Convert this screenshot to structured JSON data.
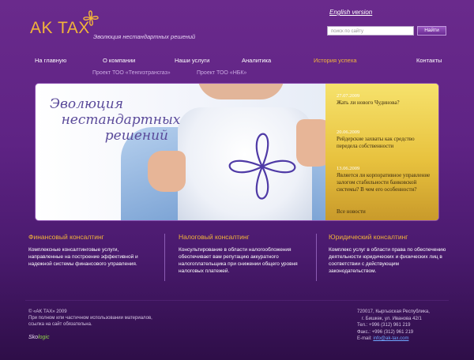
{
  "header": {
    "logo_text": "AK TAX",
    "tagline": "Эволюция нестандартных решений",
    "english_link": "English version",
    "search_placeholder": "поиск по сайту",
    "search_button": "Найти",
    "accent_color": "#f2b43a"
  },
  "nav": {
    "items": [
      {
        "label": "На главную"
      },
      {
        "label": "О компании"
      },
      {
        "label": "Наши услуги"
      },
      {
        "label": "Аналитика"
      },
      {
        "label": "История успеха"
      },
      {
        "label": "Контакты"
      }
    ],
    "active": "История успеха"
  },
  "subnav": {
    "items": [
      {
        "label": "Проект ТОО «Тенгизтрансгаз»"
      },
      {
        "label": "Проект ТОО «НБК»"
      }
    ]
  },
  "hero": {
    "title_line1": "Эволюция",
    "title_line2": "нестандартных",
    "title_line3": "решений",
    "icon": "clover-logo-icon"
  },
  "news": {
    "items": [
      {
        "date": "27.07.2009",
        "title": "Жать ли нового Чудинова?"
      },
      {
        "date": "20.06.2009",
        "title": "Рейдерские захваты как средство передела собственности"
      },
      {
        "date": "13.06.2009",
        "title": "Является ли корпоративное управление залогом стабильности банковской системы? В чем его особенности?"
      }
    ],
    "all_link": "Все новости"
  },
  "columns": [
    {
      "title": "Финансовый консалтинг",
      "text": "Комплексные консалтинговые услуги, направленные на построение эффективной и надежной системы финансового управления."
    },
    {
      "title": "Налоговый консалтинг",
      "text": "Консультирование в области налогообложения обеспечивает вам репутацию аккуратного налогоплательщика при снижении общего уровня налоговых платежей."
    },
    {
      "title": "Юридический консалтинг",
      "text": "Комплекс услуг в области права по обеспечению деятельности юридических и физических лиц в соответствии с действующим законодательством."
    }
  ],
  "footer": {
    "copyright": "© «AK TAX» 2009",
    "note_line1": "При полном или частичном использовании материалов,",
    "note_line2": "ссылка на сайт обязательна.",
    "dev_logo_part1": "Sko",
    "dev_logo_part2": "logic",
    "address_line1": "720017, Кыргызская Республика,",
    "address_line2": "г. Бишкек, ул. Иванова 42/1",
    "phone": "Тел.: +996 (312) 961 219",
    "fax": "Факс.: +996 (312) 961 219",
    "email_label": "E-mail:",
    "email": "info@ak-tax.com"
  }
}
